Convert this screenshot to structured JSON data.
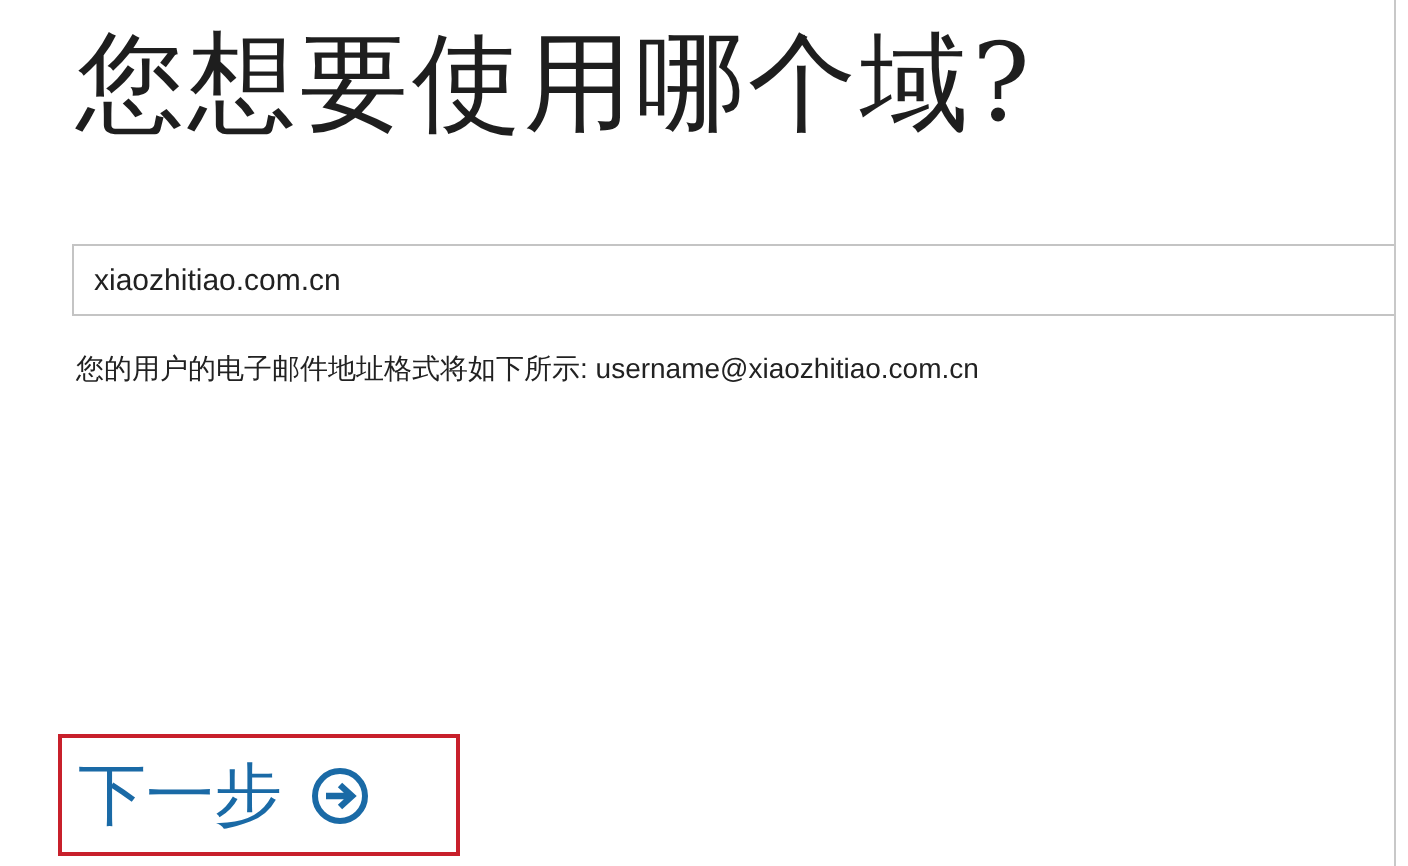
{
  "heading": "您想要使用哪个域?",
  "domain_field": {
    "value": "xiaozhitiao.com.cn"
  },
  "hint": "您的用户的电子邮件地址格式将如下所示: username@xiaozhitiao.com.cn",
  "next_button": {
    "label": "下一步",
    "highlighted": true
  }
}
